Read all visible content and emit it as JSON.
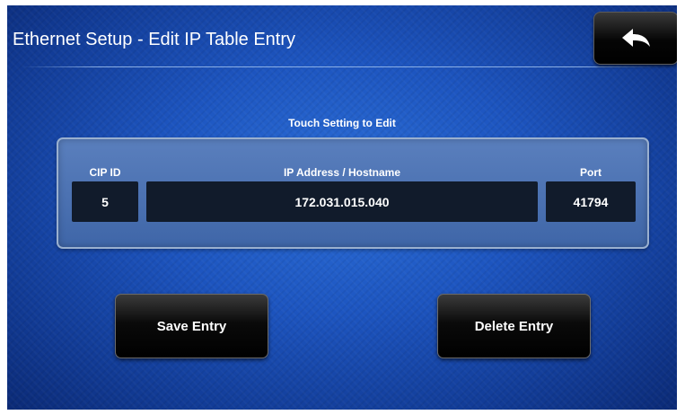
{
  "header": {
    "title": "Ethernet Setup - Edit IP Table Entry",
    "back_icon": "back-arrow-icon"
  },
  "instructions": "Touch Setting to Edit",
  "entry": {
    "columns": {
      "cip_id": "CIP ID",
      "ip_address": "IP Address / Hostname",
      "port": "Port"
    },
    "values": {
      "cip_id": "5",
      "ip_address": "172.031.015.040",
      "port": "41794"
    }
  },
  "actions": {
    "save_label": "Save Entry",
    "delete_label": "Delete Entry"
  },
  "colors": {
    "background": "#1d55c0",
    "panel": "#4a70b0",
    "field": "#111b2b",
    "button": "#000000",
    "text": "#ffffff"
  }
}
